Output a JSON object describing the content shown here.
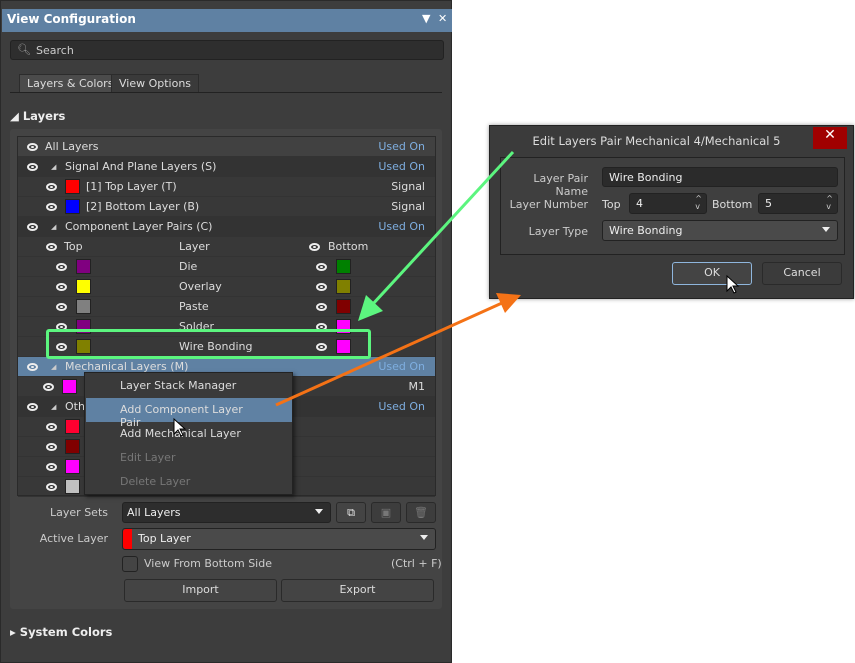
{
  "panel": {
    "title": "View Configuration",
    "search_placeholder": "Search",
    "tabs": [
      {
        "label": "Layers & Colors"
      },
      {
        "label": "View Options"
      }
    ],
    "layers_section": "Layers",
    "system_colors": "System Colors",
    "tree": {
      "all_layers": "All Layers",
      "used_on": "Used On",
      "signal_group": "Signal And Plane Layers (S)",
      "signal_layers": [
        {
          "name": "[1] Top Layer (T)",
          "type": "Signal",
          "color": "#ff0000"
        },
        {
          "name": "[2] Bottom Layer (B)",
          "type": "Signal",
          "color": "#0000ff"
        }
      ],
      "component_group": "Component Layer Pairs (C)",
      "col_top": "Top",
      "col_layer": "Layer",
      "col_bottom": "Bottom",
      "pairs": [
        {
          "name": "Die",
          "top": "#800080",
          "bottom": "#008000"
        },
        {
          "name": "Overlay",
          "top": "#ffff00",
          "bottom": "#808000"
        },
        {
          "name": "Paste",
          "top": "#808080",
          "bottom": "#800000"
        },
        {
          "name": "Solder",
          "top": "#800080",
          "bottom": "#ff00ff"
        },
        {
          "name": "Wire Bonding",
          "top": "#808000",
          "bottom": "#ff00ff"
        }
      ],
      "mech_group": "Mechanical Layers (M)",
      "mech_layer": {
        "type": "M1",
        "color": "#ff00ff"
      },
      "other_group": "Oth",
      "other_colors": [
        "#ff0030",
        "#800000",
        "#ff00ff",
        "#c0c0c0"
      ]
    },
    "context_menu": [
      {
        "label": "Layer Stack Manager",
        "enabled": true
      },
      {
        "label": "Add Component Layer Pair",
        "enabled": true,
        "highlighted": true
      },
      {
        "label": "Add Mechanical Layer",
        "enabled": true
      },
      {
        "label": "Edit Layer",
        "enabled": false
      },
      {
        "label": "Delete Layer",
        "enabled": false
      }
    ],
    "layer_sets_label": "Layer Sets",
    "layer_sets_value": "All Layers",
    "active_layer_label": "Active Layer",
    "active_layer_value": "Top Layer",
    "active_layer_color": "#ff0000",
    "view_bottom_label": "View From Bottom Side",
    "view_bottom_shortcut": "(Ctrl + F)",
    "import": "Import",
    "export": "Export"
  },
  "dialog": {
    "title": "Edit Layers Pair Mechanical 4/Mechanical 5",
    "close": "✕",
    "pair_name_label": "Layer Pair Name",
    "pair_name": "Wire Bonding",
    "layer_number_label": "Layer Number",
    "top_label": "Top",
    "top_value": "4",
    "bottom_label": "Bottom",
    "bottom_value": "5",
    "layer_type_label": "Layer Type",
    "layer_type": "Wire Bonding",
    "ok": "OK",
    "cancel": "Cancel"
  },
  "colors": {
    "accent": "#5f81a3",
    "highlight": "#5cf57f",
    "arrow_orange": "#f47216"
  }
}
